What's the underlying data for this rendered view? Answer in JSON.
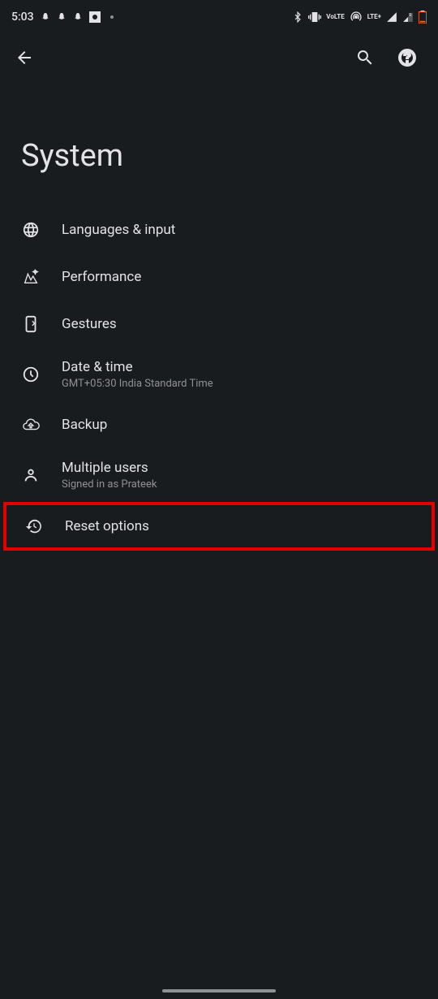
{
  "statusBar": {
    "time": "5:03",
    "volte": "VoLTE",
    "lte": "LTE+"
  },
  "page": {
    "title": "System"
  },
  "settings": [
    {
      "icon": "globe",
      "title": "Languages & input",
      "subtitle": null
    },
    {
      "icon": "performance",
      "title": "Performance",
      "subtitle": null
    },
    {
      "icon": "gestures",
      "title": "Gestures",
      "subtitle": null
    },
    {
      "icon": "clock",
      "title": "Date & time",
      "subtitle": "GMT+05:30 India Standard Time"
    },
    {
      "icon": "backup",
      "title": "Backup",
      "subtitle": null
    },
    {
      "icon": "users",
      "title": "Multiple users",
      "subtitle": "Signed in as Prateek"
    },
    {
      "icon": "reset",
      "title": "Reset options",
      "subtitle": null,
      "highlighted": true
    }
  ]
}
